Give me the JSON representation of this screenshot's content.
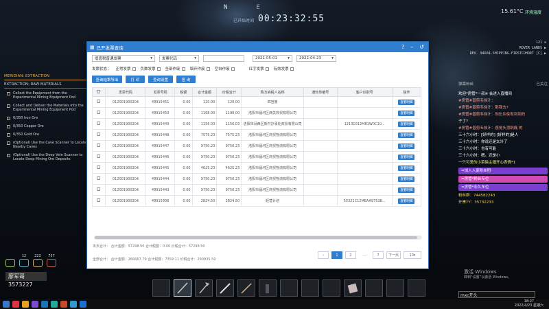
{
  "hud": {
    "compass_n": "N",
    "compass_e": "E",
    "timer_label": "已开始时间",
    "timer": "00:23:32:55",
    "temperature": "15.61°C",
    "temperature_label": "环境温度",
    "rover": [
      "121 ⊙",
      "ROVER LANDS ▶",
      "REV. 94684-SHIPPING-FIRSTCOHORT [C] ▶"
    ]
  },
  "objectives": {
    "header": "MERIDIAN: EXTRACTION",
    "sub": "EXTRACTION: RAW MATERIALS",
    "items": [
      "Collect the Equipment from the Experimental Mining Equipment Pod",
      "Collect and Deliver the Materials into the Experimental Mining Equipment Pod",
      "0/350 Iron Ore",
      "0/350 Copper Ore",
      "0/350 Gold Ore",
      "(Optional) Use the Cave Scanner to Locate Nearby Caves",
      "(Optional) Use the Deep Vein Scanner to Locate Deep Mining Ore Deposits"
    ]
  },
  "stats": {
    "v1": "12",
    "v2": "222",
    "v3": "757"
  },
  "player": {
    "name": "廖军哥",
    "id": "3573227"
  },
  "dialog": {
    "title": "已开发票查询",
    "filters": {
      "invoice_type": "增值税普通发票",
      "code_label": "发票代码",
      "date_from": "2021-05-01",
      "date_to": "2022-04-23"
    },
    "status_label": "发票状态：",
    "checks": [
      "正常发票",
      "负数发票",
      "全部作废",
      "填开作废",
      "空白作废",
      "红字发票"
    ],
    "checks2": [
      "有效发票"
    ],
    "buttons": [
      "查询结果导出",
      "打 印",
      "查询设置",
      "查 询"
    ],
    "columns": [
      "",
      "发票代码",
      "发票号码",
      "税额",
      "合计金额",
      "价税合计",
      "购方纳税人名称",
      "通知单编号",
      "客户识别号",
      "操作"
    ],
    "rows": [
      [
        "012001900204",
        "48915451",
        "0.00",
        "120.00",
        "120.00",
        "四宫第",
        "",
        "",
        "查看明细"
      ],
      [
        "012001900204",
        "48915450",
        "0.00",
        "1198.00",
        "1198.00",
        "洛阳市瀍河区西关商贸有限公司",
        "",
        "",
        "查看明细"
      ],
      [
        "012001900204",
        "48915449",
        "0.00",
        "1156.03",
        "1156.03",
        "洛阳市涧西区新村办事处商贸有限公司",
        "",
        "12131012MB1W0C10...",
        "查看明细"
      ],
      [
        "012001900204",
        "48915448",
        "0.00",
        "7575.23",
        "7575.23",
        "洛阳市瀍河区商贸物流有限公司",
        "",
        "",
        "查看明细"
      ],
      [
        "012001900204",
        "48915447",
        "0.00",
        "9750.23",
        "9750.23",
        "洛阳市瀍河区商贸物流有限公司",
        "",
        "",
        "查看明细"
      ],
      [
        "012001900204",
        "48915446",
        "0.00",
        "9750.23",
        "9750.23",
        "洛阳市瀍河区商贸物流有限公司",
        "",
        "",
        "查看明细"
      ],
      [
        "012001900204",
        "48915445",
        "0.00",
        "4625.23",
        "4625.23",
        "洛阳市瀍河区商贸物流有限公司",
        "",
        "",
        "查看明细"
      ],
      [
        "012001900204",
        "48915444",
        "0.00",
        "9750.23",
        "9750.23",
        "洛阳市瀍河区商贸物流有限公司",
        "",
        "",
        "查看明细"
      ],
      [
        "012001900204",
        "48915443",
        "0.00",
        "9750.23",
        "9750.23",
        "洛阳市瀍河区商贸物流有限公司",
        "",
        "",
        "查看明细"
      ],
      [
        "012001900204",
        "48915936",
        "0.00",
        "2824.50",
        "2824.50",
        "经营计划",
        "",
        "55321C12MEAA97538...",
        "查看明细"
      ]
    ],
    "summary1": "本页合计：  合计金额：57298.50    合计税额：0.00    价税合计：57298.50",
    "summary2": "全部合计：  合计金额：266667.79  合计税额：7359.11   价税合计：290935.50",
    "pager": [
      "‹",
      "1",
      "2",
      "...",
      "7",
      "下一页",
      "10"
    ]
  },
  "chat": {
    "header_left": "弹幕粉丝",
    "header_right": "已关注",
    "lines": [
      "欢迎*房管*一叔※ 会进入直播间",
      "#房管#普剪韦徐汁：",
      "#房管#普剪韦徐汁：那我去?",
      "#房管#普剪韦徐汁：你比许俊有到到的",
      "子了?",
      "#房管#普剪韦徐汁：感觉头顶刺痛 的",
      "三十六小时：[好样的] [好样的]是人",
      "三十六小时：你说还是太冷了",
      "三十六小时：也有可能",
      "三十六小时：嗯。还是小",
      "一只可爱的小菜猫主播开心表情*1"
    ],
    "ribbons": [
      "=加入入宴粉丝团",
      "=房管*粉丝专位",
      "=房管*永久车位"
    ],
    "fans1": "粉丝群：744582243",
    "fans2": "开黑YY：35732233"
  },
  "notice": {
    "line1": "激活 Windows",
    "line2": "转到“设置”以激活 Windows。"
  },
  "chat_input": "mxc开头",
  "clock": {
    "time": "18:27",
    "date": "2022/4/23 星期六"
  }
}
